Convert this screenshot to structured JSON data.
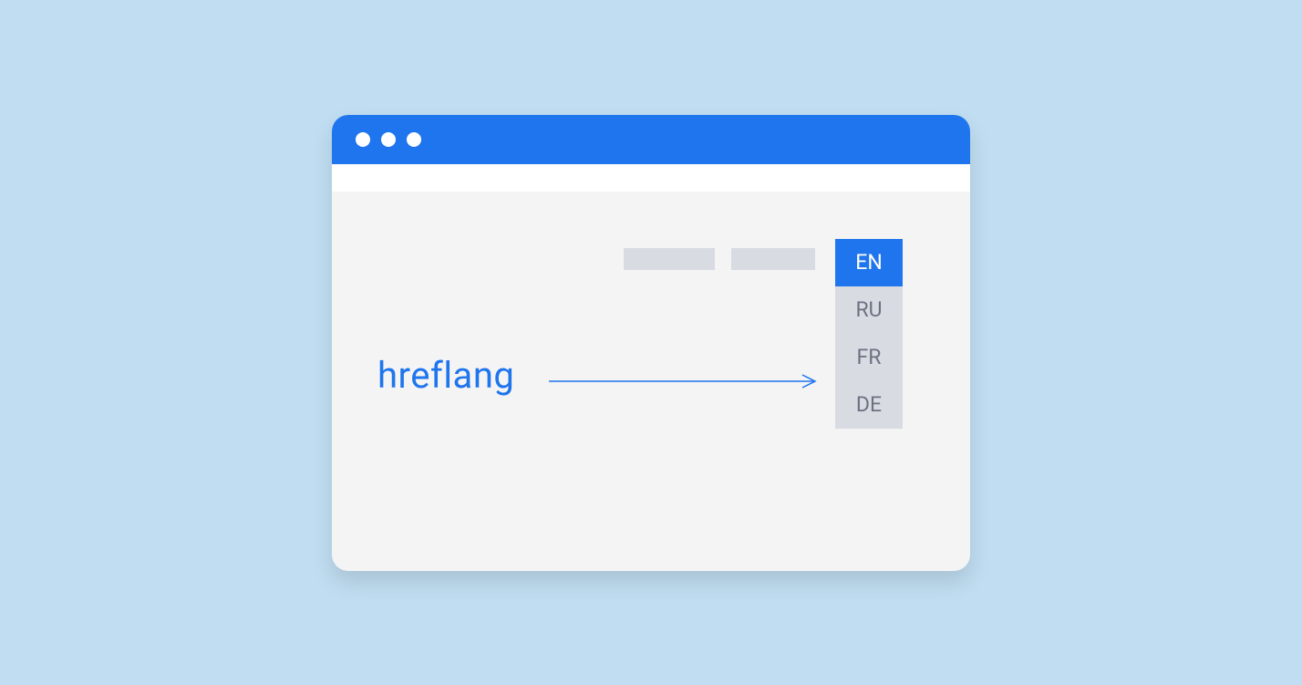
{
  "label": "hreflang",
  "languages": [
    {
      "code": "EN",
      "active": true
    },
    {
      "code": "RU",
      "active": false
    },
    {
      "code": "FR",
      "active": false
    },
    {
      "code": "DE",
      "active": false
    }
  ],
  "colors": {
    "background": "#c0ddf1",
    "accent": "#1f75ed",
    "window_bg": "#f4f4f4",
    "placeholder": "#d9dbe3",
    "text_muted": "#6b7280"
  }
}
